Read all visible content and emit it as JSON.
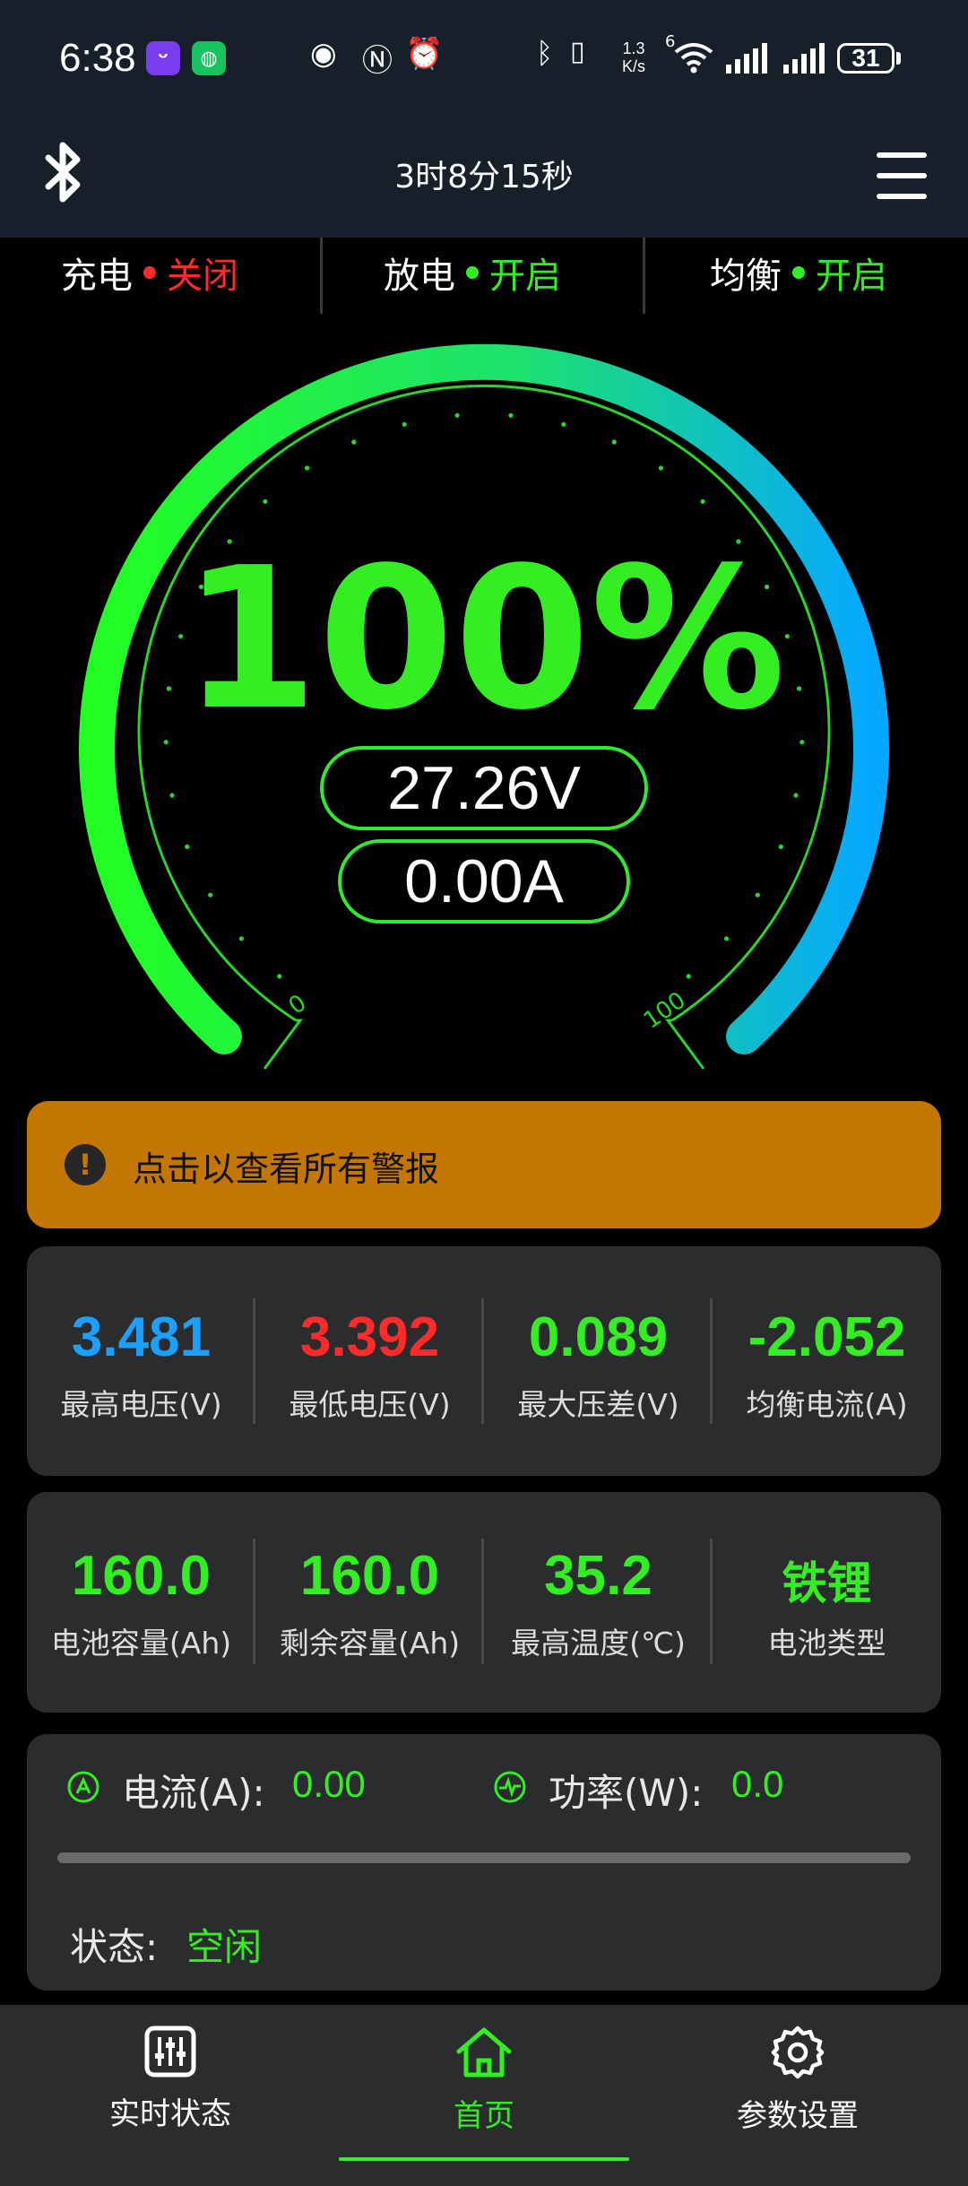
{
  "status_bar": {
    "time": "6:38",
    "speed_top": "1.3",
    "speed_bottom": "K/s",
    "network_badge": "6",
    "battery_level": "31",
    "icons": [
      "app-badge-icon",
      "wechat-icon",
      "eye-icon",
      "nfc-icon",
      "alarm-icon",
      "bluetooth-icon",
      "vibrate-icon",
      "wifi-icon",
      "signal-icon",
      "signal-icon",
      "battery-icon"
    ]
  },
  "header": {
    "title": "3时8分15秒"
  },
  "switches": [
    {
      "label": "充电",
      "state": "关闭",
      "color": "#ff2a2a"
    },
    {
      "label": "放电",
      "state": "开启",
      "color": "#33ee22"
    },
    {
      "label": "均衡",
      "state": "开启",
      "color": "#33ee22"
    }
  ],
  "gauge": {
    "percent": "100%",
    "soc_fraction": 1.0,
    "voltage": "27.26V",
    "current": "0.00A",
    "min_label": "0",
    "max_label": "100",
    "colors": {
      "start": "#22ff22",
      "end": "#06a8ff"
    }
  },
  "alert": {
    "text": "点击以查看所有警报",
    "color": "#c47700"
  },
  "cell_stats": [
    {
      "value": "3.481",
      "label": "最高电压(V)",
      "color": "#1aa0ff"
    },
    {
      "value": "3.392",
      "label": "最低电压(V)",
      "color": "#ff2a2a"
    },
    {
      "value": "0.089",
      "label": "最大压差(V)",
      "color": "#33ee22"
    },
    {
      "value": "-2.052",
      "label": "均衡电流(A)",
      "color": "#33ee22"
    }
  ],
  "pack_stats": [
    {
      "value": "160.0",
      "label": "电池容量(Ah)",
      "color": "#33ee22"
    },
    {
      "value": "160.0",
      "label": "剩余容量(Ah)",
      "color": "#33ee22"
    },
    {
      "value": "35.2",
      "label": "最高温度(℃)",
      "color": "#33ee22"
    },
    {
      "value": "铁锂",
      "label": "电池类型",
      "color": "#33ee22"
    }
  ],
  "flow": {
    "current_label": "电流(A):",
    "current_value": "0.00",
    "power_label": "功率(W):",
    "power_value": "0.0",
    "progress_fraction": 0.0,
    "status_label": "状态:",
    "status_value": "空闲"
  },
  "nav": [
    {
      "label": "实时状态",
      "icon": "sliders-icon",
      "active": false
    },
    {
      "label": "首页",
      "icon": "home-icon",
      "active": true
    },
    {
      "label": "参数设置",
      "icon": "gear-icon",
      "active": false
    }
  ],
  "accent": "#33ee22"
}
